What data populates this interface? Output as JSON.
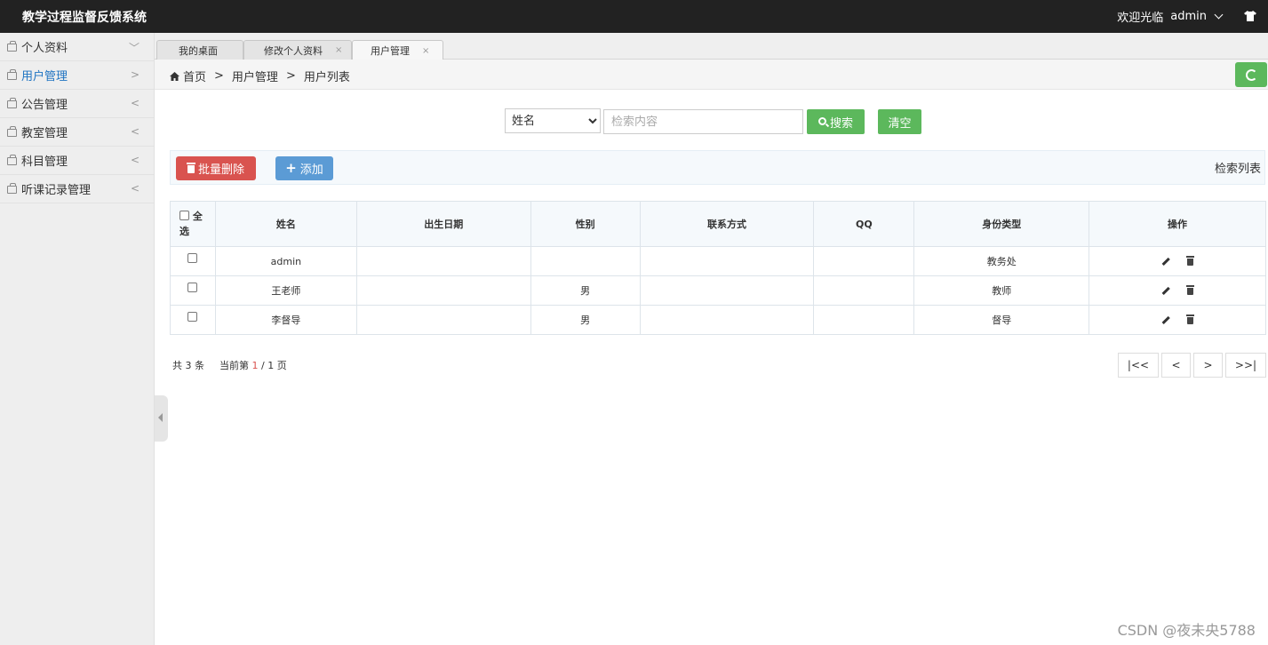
{
  "header": {
    "app_title": "教学过程监督反馈系统",
    "welcome": "欢迎光临",
    "username": "admin"
  },
  "sidebar": {
    "items": [
      {
        "label": "个人资料",
        "arrow": "﹀"
      },
      {
        "label": "用户管理",
        "arrow": ">"
      },
      {
        "label": "公告管理",
        "arrow": "<"
      },
      {
        "label": "教室管理",
        "arrow": "<"
      },
      {
        "label": "科目管理",
        "arrow": "<"
      },
      {
        "label": "听课记录管理",
        "arrow": "<"
      }
    ]
  },
  "tabs": [
    {
      "label": "我的桌面",
      "close": ""
    },
    {
      "label": "修改个人资料",
      "close": "×"
    },
    {
      "label": "用户管理",
      "close": "×"
    }
  ],
  "breadcrumb": {
    "home": "首页",
    "sep": ">",
    "level1": "用户管理",
    "level2": "用户列表"
  },
  "search": {
    "field_selected": "姓名",
    "placeholder": "检索内容",
    "value": "",
    "search_label": "搜索",
    "clear_label": "清空"
  },
  "toolbar": {
    "batch_delete_label": "批量删除",
    "add_label": "添加",
    "list_title": "检索列表"
  },
  "table": {
    "select_all": "全选",
    "columns": [
      "姓名",
      "出生日期",
      "性别",
      "联系方式",
      "QQ",
      "身份类型",
      "操作"
    ],
    "rows": [
      {
        "name": "admin",
        "birth": "",
        "gender": "",
        "contact": "",
        "qq": "",
        "role": "教务处"
      },
      {
        "name": "王老师",
        "birth": "",
        "gender": "男",
        "contact": "",
        "qq": "",
        "role": "教师"
      },
      {
        "name": "李督导",
        "birth": "",
        "gender": "男",
        "contact": "",
        "qq": "",
        "role": "督导"
      }
    ]
  },
  "pagination": {
    "total": "共 3 条",
    "current_prefix": "当前第",
    "current_page": "1",
    "page_suffix": "/ 1 页",
    "first": "|<<",
    "prev": "<",
    "next": ">",
    "last": ">>|"
  },
  "watermark": "CSDN @夜未央5788",
  "colors": {
    "accent_green": "#5cb85c",
    "danger_red": "#d9534f",
    "primary_blue": "#5b9bd5",
    "topbar": "#222222"
  }
}
